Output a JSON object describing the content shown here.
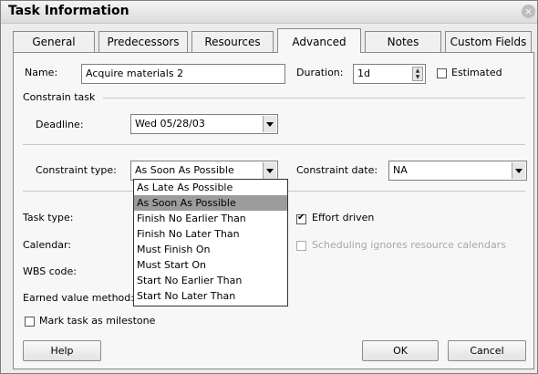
{
  "window": {
    "title": "Task Information",
    "close": "×"
  },
  "tabs": [
    {
      "label": "General"
    },
    {
      "label": "Predecessors"
    },
    {
      "label": "Resources"
    },
    {
      "label": "Advanced"
    },
    {
      "label": "Notes"
    },
    {
      "label": "Custom Fields"
    }
  ],
  "active_tab": "Advanced",
  "form": {
    "name_label": "Name:",
    "name_value": "Acquire materials 2",
    "duration_label": "Duration:",
    "duration_value": "1d",
    "estimated_label": "Estimated",
    "estimated_checked": false,
    "constrain_group_label": "Constrain task",
    "deadline_label": "Deadline:",
    "deadline_value": "Wed 05/28/03",
    "constraint_type_label": "Constraint type:",
    "constraint_type_value": "As Soon As Possible",
    "constraint_date_label": "Constraint date:",
    "constraint_date_value": "NA",
    "constraint_type_options": [
      "As Late As Possible",
      "As Soon As Possible",
      "Finish No Earlier Than",
      "Finish No Later Than",
      "Must Finish On",
      "Must Start On",
      "Start No Earlier Than",
      "Start No Later Than"
    ],
    "selected_option": "As Soon As Possible",
    "task_type_label": "Task type:",
    "calendar_label": "Calendar:",
    "wbs_label": "WBS code:",
    "earned_value_label": "Earned value method:",
    "effort_driven_label": "Effort driven",
    "effort_driven_checked": true,
    "scheduling_ignores_label": "Scheduling ignores resource calendars",
    "scheduling_ignores_checked": false,
    "milestone_label": "Mark task as milestone",
    "milestone_checked": false
  },
  "buttons": {
    "help": "Help",
    "ok": "OK",
    "cancel": "Cancel"
  }
}
